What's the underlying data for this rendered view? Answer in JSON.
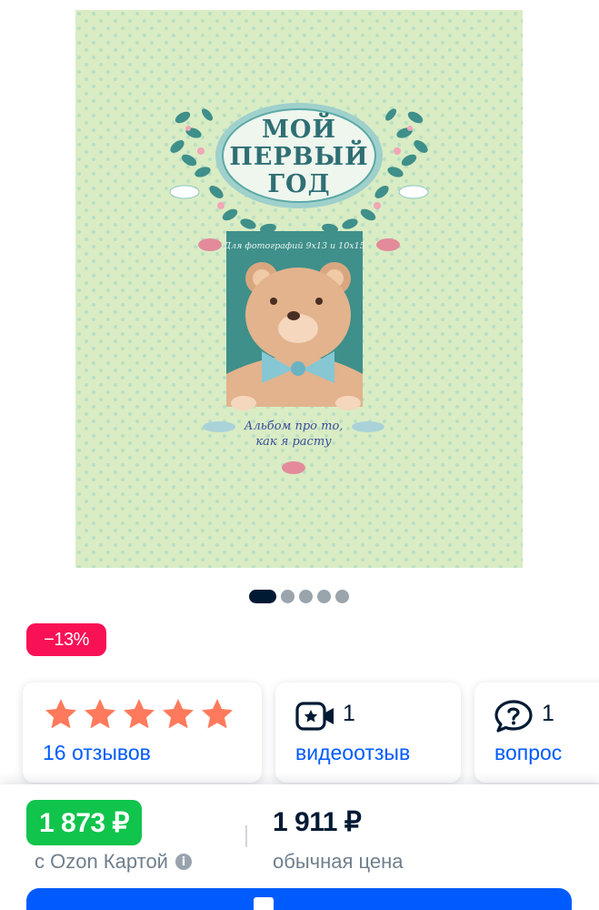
{
  "product_image": {
    "title_lines": [
      "МОЙ",
      "ПЕРВЫЙ",
      "ГОД"
    ],
    "photo_note": "Для фотографий 9х13 и 10х15",
    "subtitle_lines": [
      "Альбом про то,",
      "как я расту"
    ]
  },
  "gallery": {
    "total_images": 5,
    "active_index": 0
  },
  "discount": {
    "label": "−13%"
  },
  "colors": {
    "accent_blue": "#005bff",
    "price_green": "#10c44c",
    "discount_pink": "#f91155",
    "star_orange": "#ff7a5c",
    "cover_green": "#d9ecc4"
  },
  "cards": {
    "reviews": {
      "rating": 5,
      "icon": "star-icon",
      "link": "16 отзывов"
    },
    "videos": {
      "icon": "video-camera-icon",
      "count": "1",
      "link": "видеоотзыв"
    },
    "questions": {
      "icon": "question-bubble-icon",
      "count": "1",
      "link": "вопрос"
    }
  },
  "price": {
    "ozon_card_price": "1 873 ₽",
    "ozon_card_caption": "с Ozon Картой",
    "ozon_card_info_icon": "info-icon",
    "regular_price": "1 911 ₽",
    "regular_caption": "обычная цена"
  }
}
